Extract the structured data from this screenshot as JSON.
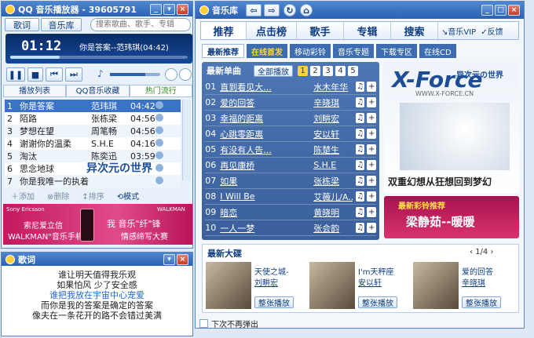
{
  "player": {
    "title": "QQ 音乐播放器 - 39605791",
    "tab_lyrics": "歌词",
    "tab_library": "音乐库",
    "search_placeholder": "搜索歌曲、歌手、专辑",
    "time": "01:12",
    "now_playing": "你是答案--范玮琪(04:42)"
  },
  "playlist": {
    "tabs": [
      "播放列表",
      "QQ音乐收藏",
      "热门流行"
    ],
    "rows": [
      {
        "n": "1",
        "title": "你是答案",
        "artist": "范玮琪",
        "dur": "04:42"
      },
      {
        "n": "2",
        "title": "陌路",
        "artist": "张栋梁",
        "dur": "04:56"
      },
      {
        "n": "3",
        "title": "梦想在望",
        "artist": "周笔畅",
        "dur": "04:56"
      },
      {
        "n": "4",
        "title": "谢谢你的温柔",
        "artist": "S.H.E",
        "dur": "04:16"
      },
      {
        "n": "5",
        "title": "淘汰",
        "artist": "陈奕迅",
        "dur": "03:59"
      },
      {
        "n": "6",
        "title": "思念地球",
        "artist": "",
        "dur": ""
      },
      {
        "n": "7",
        "title": "你是我唯一的执着",
        "artist": "",
        "dur": ""
      }
    ],
    "tools": [
      "添加",
      "删除",
      "排序",
      "模式"
    ]
  },
  "ad": {
    "brand": "Sony Ericsson",
    "line1": "索尼爱立信",
    "line2": "WALKMAN\"音乐手机",
    "slogan1": "我 音乐\"纤\"锋",
    "slogan2": "情感缔写大赛",
    "walkman": "WALKMAN"
  },
  "lyrics": {
    "title": "歌词",
    "lines": [
      "谁让明天值得我乐观",
      "如果怕风  少了安全感",
      "谁把我放在宇宙中心宠爱",
      "而你是我的答案是确定的答案",
      "像夫在一条花开的路不会错过美满"
    ]
  },
  "library": {
    "title": "音乐库",
    "vip": "音乐VIP",
    "feedback": "反馈",
    "main_tabs": [
      "推荐",
      "点击榜",
      "歌手",
      "专辑",
      "搜索"
    ],
    "sub_tabs": [
      "最新推荐",
      "在线首发",
      "移动彩铃",
      "音乐专题",
      "下载专区",
      "在线CD"
    ],
    "single_title": "最新单曲",
    "play_all": "全部播放",
    "pages": [
      "1",
      "2",
      "3",
      "4",
      "5"
    ],
    "songs": [
      {
        "n": "01",
        "t": "直到看见大...",
        "a": "水木年华"
      },
      {
        "n": "02",
        "t": "爱的回答",
        "a": "辛晓琪"
      },
      {
        "n": "03",
        "t": "幸福的距离",
        "a": "刘畊宏"
      },
      {
        "n": "04",
        "t": "心跳零距离",
        "a": "安以轩"
      },
      {
        "n": "05",
        "t": "有没有人告...",
        "a": "陈楚生"
      },
      {
        "n": "06",
        "t": "再见康桥",
        "a": "S.H.E"
      },
      {
        "n": "07",
        "t": "如果",
        "a": "张栋梁"
      },
      {
        "n": "08",
        "t": "I Will Be",
        "a": "艾薇儿/A..."
      },
      {
        "n": "09",
        "t": "暗恋",
        "a": "黄晓明"
      },
      {
        "n": "10",
        "t": "一人一梦",
        "a": "张会韵"
      }
    ],
    "banner_cn": "异次元の世界",
    "banner_en": "X-Force",
    "banner_site": "WWW.X-FORCE.CN",
    "banner_text": "双重幻想从狂想回到梦幻",
    "ring_title": "最新彩铃推荐",
    "ring_song": "梁静茹--暖暖",
    "albums_title": "最新大碟",
    "albums_page": "1/4",
    "albums": [
      {
        "name": "天使之城-",
        "artist": "刘畊宏",
        "btn": "整张播放"
      },
      {
        "name": "I'm天秤座",
        "artist": "安以轩",
        "btn": "整张播放"
      },
      {
        "name": "爱的回答",
        "artist": "辛晓琪",
        "btn": "整张播放"
      }
    ],
    "no_popup": "下次不再弹出"
  }
}
